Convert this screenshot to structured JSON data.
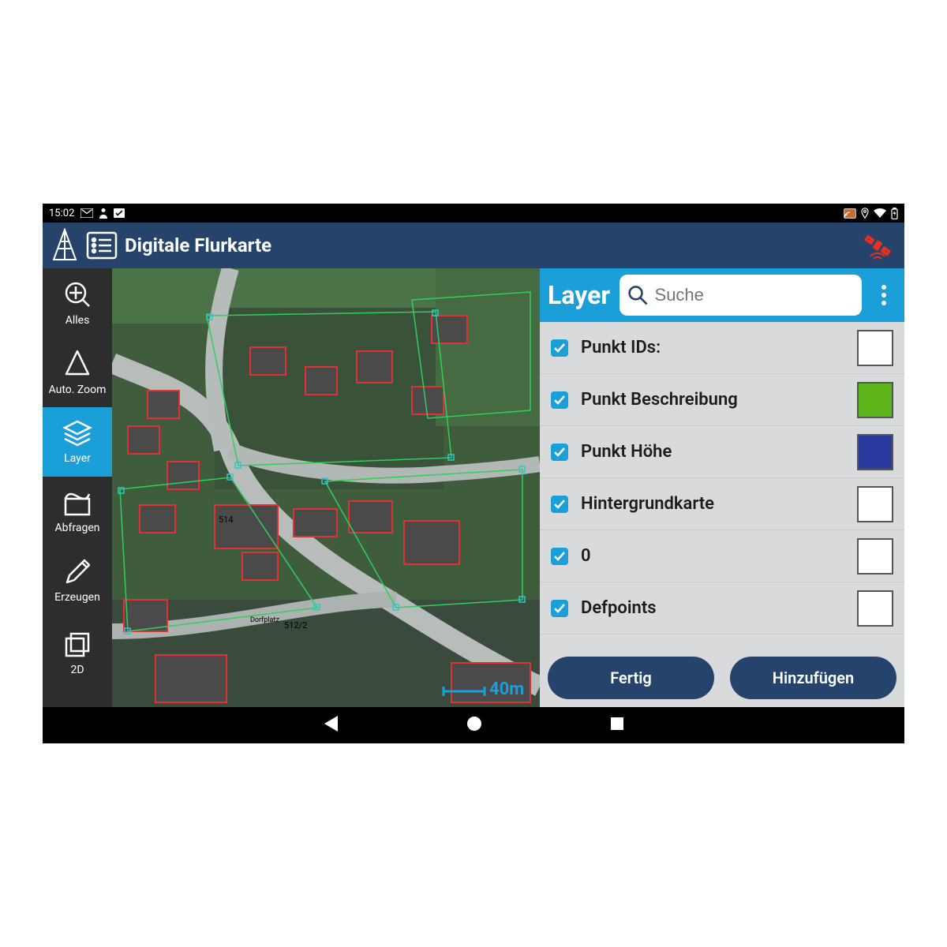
{
  "status": {
    "time": "15:02"
  },
  "appbar": {
    "title": "Digitale Flurkarte"
  },
  "sidebar": {
    "items": [
      {
        "label": "Alles"
      },
      {
        "label": "Auto. Zoom"
      },
      {
        "label": "Layer"
      },
      {
        "label": "Abfragen"
      },
      {
        "label": "Erzeugen"
      },
      {
        "label": "2D"
      }
    ]
  },
  "layer_panel": {
    "title": "Layer",
    "search_placeholder": "Suche",
    "rows": [
      {
        "label": "Punkt IDs:",
        "checked": true,
        "color": "#ffffff"
      },
      {
        "label": "Punkt Beschreibung",
        "checked": true,
        "color": "#5bb41a"
      },
      {
        "label": "Punkt Höhe",
        "checked": true,
        "color": "#2b3a9e"
      },
      {
        "label": "Hintergrundkarte",
        "checked": true,
        "color": "#ffffff"
      },
      {
        "label": "0",
        "checked": true,
        "color": "#ffffff"
      },
      {
        "label": "Defpoints",
        "checked": true,
        "color": "#ffffff"
      }
    ],
    "buttons": {
      "done": "Fertig",
      "add": "Hinzufügen"
    }
  },
  "map": {
    "scale_label": "40m",
    "labels": [
      "514",
      "512/2",
      "Dorfplatz"
    ]
  }
}
